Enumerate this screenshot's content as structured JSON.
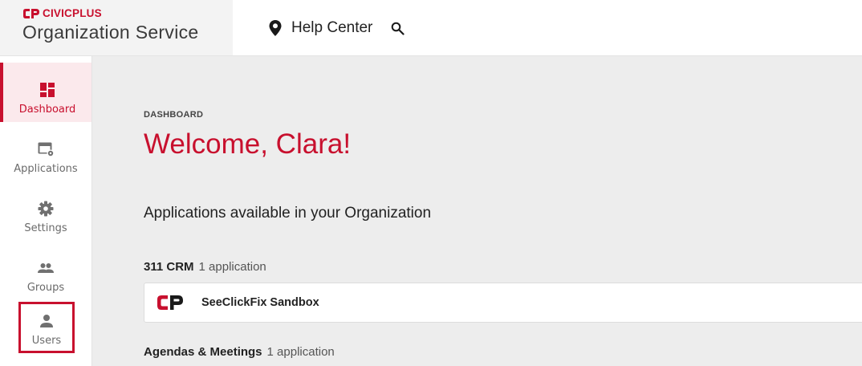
{
  "brand": {
    "logo_text": "CIVICPLUS",
    "product": "Organization Service",
    "accent": "#c8102e"
  },
  "topbar": {
    "help_label": "Help Center",
    "help_icon": "location-pin-icon",
    "search_icon": "search-icon"
  },
  "sidebar": {
    "items": [
      {
        "label": "Dashboard",
        "icon": "dashboard-icon",
        "active": true
      },
      {
        "label": "Applications",
        "icon": "applications-icon",
        "active": false
      },
      {
        "label": "Settings",
        "icon": "gear-icon",
        "active": false
      },
      {
        "label": "Groups",
        "icon": "groups-icon",
        "active": false
      },
      {
        "label": "Users",
        "icon": "user-icon",
        "active": false,
        "highlighted": true
      }
    ]
  },
  "main": {
    "breadcrumb": "DASHBOARD",
    "welcome": "Welcome, Clara!",
    "section_title": "Applications available in your Organization",
    "groups": [
      {
        "name": "311 CRM",
        "count": "1 application",
        "apps": [
          {
            "name": "SeeClickFix Sandbox",
            "icon": "civicplus-logo-icon"
          }
        ]
      },
      {
        "name": "Agendas & Meetings",
        "count": "1 application",
        "apps": []
      }
    ]
  }
}
